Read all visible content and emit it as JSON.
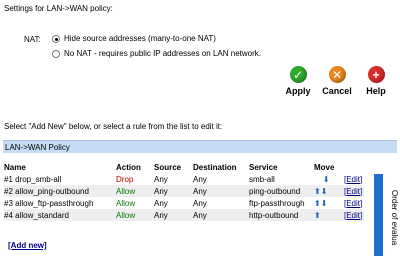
{
  "settings": {
    "title": "Settings for LAN->WAN policy:"
  },
  "nat": {
    "label": "NAT:",
    "options": [
      {
        "label": "Hide source addresses (many-to-one NAT)",
        "checked": true
      },
      {
        "label": "No NAT - requires public IP addresses on LAN network.",
        "checked": false
      }
    ]
  },
  "actions": {
    "apply": "Apply",
    "cancel": "Cancel",
    "help": "Help",
    "colors": {
      "apply": "#2eaa2e",
      "cancel": "#e8871e",
      "help": "#d92c2c"
    }
  },
  "instruction": "Select \"Add New\" below, or select a rule from the list to edit it:",
  "policy": {
    "title": "LAN->WAN Policy",
    "columns": [
      "Name",
      "Action",
      "Source",
      "Destination",
      "Service",
      "Move"
    ],
    "rows": [
      {
        "name": "#1 drop_smb-all",
        "action": "Drop",
        "source": "Any",
        "destination": "Any",
        "service": "smb-all",
        "edit": "[Edit]"
      },
      {
        "name": "#2 allow_ping-outbound",
        "action": "Allow",
        "source": "Any",
        "destination": "Any",
        "service": "ping-outbound",
        "edit": "[Edit]"
      },
      {
        "name": "#3 allow_ftp-passthrough",
        "action": "Allow",
        "source": "Any",
        "destination": "Any",
        "service": "ftp-passthrough",
        "edit": "[Edit]"
      },
      {
        "name": "#4 allow_standard",
        "action": "Allow",
        "source": "Any",
        "destination": "Any",
        "service": "http-outbound",
        "edit": "[Edit]"
      }
    ],
    "add_new": "[Add new]",
    "order_label": "Order of evalua"
  }
}
